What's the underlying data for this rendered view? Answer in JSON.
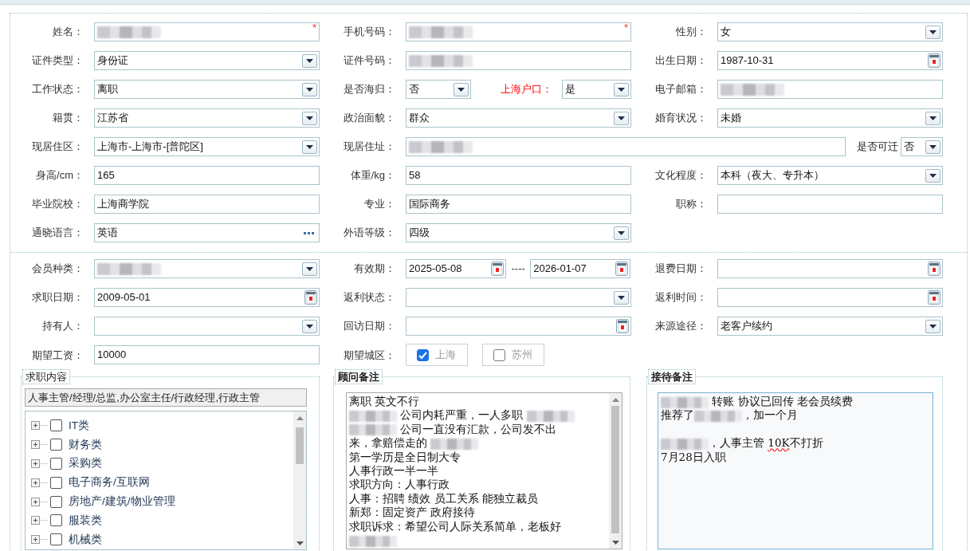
{
  "basic_rows": [
    [
      {
        "label": "姓名：",
        "field": {
          "kind": "text",
          "redacted": true,
          "required_mark": "*"
        }
      },
      {
        "label": "手机号码：",
        "field": {
          "kind": "text",
          "redacted": true,
          "required_mark": "*"
        }
      },
      {
        "label": "性别：",
        "field": {
          "kind": "select",
          "value": "女"
        }
      }
    ],
    [
      {
        "label": "证件类型：",
        "field": {
          "kind": "select",
          "value": "身份证"
        }
      },
      {
        "label": "证件号码：",
        "field": {
          "kind": "text",
          "redacted": true
        }
      },
      {
        "label": "出生日期：",
        "field": {
          "kind": "date",
          "value": "1987-10-31"
        }
      }
    ],
    [
      {
        "label": "工作状态：",
        "field": {
          "kind": "select",
          "value": "离职"
        }
      },
      {
        "label": "是否海归：",
        "field": {
          "kind": "select",
          "value": "否"
        },
        "extra": {
          "label": "上海户口：",
          "highlighted": true,
          "field": {
            "kind": "select",
            "value": "是"
          }
        }
      },
      {
        "label": "电子邮箱：",
        "field": {
          "kind": "text",
          "redacted": true
        }
      }
    ],
    [
      {
        "label": "籍贯：",
        "field": {
          "kind": "select",
          "value": "江苏省"
        }
      },
      {
        "label": "政治面貌：",
        "field": {
          "kind": "select",
          "value": "群众"
        }
      },
      {
        "label": "婚育状况：",
        "field": {
          "kind": "select",
          "value": "未婚"
        }
      }
    ],
    [
      {
        "label": "现居住区：",
        "field": {
          "kind": "select",
          "value": " 上海市-上海市-[普陀区]"
        }
      },
      {
        "label": "现居住址：",
        "wide": true,
        "field": {
          "kind": "text",
          "redacted": true
        },
        "extra": {
          "label": "是否可迁",
          "highlighted": false,
          "field": {
            "kind": "select",
            "value": "否"
          }
        }
      }
    ],
    [
      {
        "label": "身高/cm：",
        "field": {
          "kind": "text",
          "value": "165"
        }
      },
      {
        "label": "体重/kg：",
        "field": {
          "kind": "text",
          "value": "58"
        }
      },
      {
        "label": "文化程度：",
        "field": {
          "kind": "select",
          "value": "本科（夜大、专升本）"
        }
      }
    ],
    [
      {
        "label": "毕业院校：",
        "field": {
          "kind": "text",
          "value": "上海商学院"
        }
      },
      {
        "label": "专业：",
        "field": {
          "kind": "text",
          "value": "国际商务"
        }
      },
      {
        "label": "职称：",
        "field": {
          "kind": "text"
        }
      }
    ],
    [
      {
        "label": "通晓语言：",
        "field": {
          "kind": "picker",
          "value": "英语"
        }
      },
      {
        "label": "外语等级：",
        "field": {
          "kind": "select",
          "value": "四级"
        }
      }
    ]
  ],
  "member_rows": [
    [
      {
        "label": "会员种类：",
        "field": {
          "kind": "select",
          "redacted": true
        }
      },
      {
        "label": "有效期：",
        "field": {
          "kind": "date_range",
          "separator": "----",
          "values": [
            {
              "value": "2025-05-08"
            },
            {
              "value": "2026-01-07"
            }
          ]
        }
      },
      {
        "label": "退费日期：",
        "field": {
          "kind": "date"
        }
      }
    ],
    [
      {
        "label": "求职日期：",
        "field": {
          "kind": "date",
          "value": "2009-05-01"
        }
      },
      {
        "label": "返利状态：",
        "field": {
          "kind": "select"
        }
      },
      {
        "label": "返利时间：",
        "field": {
          "kind": "date"
        }
      }
    ],
    [
      {
        "label": "持有人：",
        "field": {
          "kind": "select"
        }
      },
      {
        "label": "回访日期：",
        "field": {
          "kind": "date"
        }
      },
      {
        "label": "来源途径：",
        "field": {
          "kind": "select",
          "value": "老客户续约"
        }
      }
    ],
    [
      {
        "label": "期望工资：",
        "field": {
          "kind": "text",
          "value": "10000"
        }
      },
      {
        "label": "期望城区：",
        "field": {
          "kind": "checkboxes",
          "options": [
            {
              "label": "上海",
              "checked": true
            },
            {
              "label": "苏州",
              "checked": false
            }
          ]
        }
      }
    ]
  ],
  "panels": [
    {
      "kind": "tree",
      "title": "求职内容",
      "emphasized": false,
      "summary": "人事主管/经理/总监,办公室主任/行政经理,行政主管",
      "items": [
        {
          "label": "IT类",
          "expanded": false,
          "checked": false
        },
        {
          "label": "财务类",
          "expanded": false,
          "checked": false
        },
        {
          "label": "采购类",
          "expanded": false,
          "checked": false
        },
        {
          "label": "电子商务/互联网",
          "expanded": false,
          "checked": false
        },
        {
          "label": "房地产/建筑/物业管理",
          "expanded": false,
          "checked": false
        },
        {
          "label": "服装类",
          "expanded": false,
          "checked": false
        },
        {
          "label": "机械类",
          "expanded": false,
          "checked": false
        }
      ]
    },
    {
      "kind": "notes",
      "title": "顾问备注",
      "emphasized": true,
      "focused": false,
      "lines": [
        {
          "segments": [
            {
              "text": "离职  英文不行"
            }
          ]
        },
        {
          "segments": [
            {
              "redacted": true
            },
            {
              "text": " 公司内耗严重，一人多职 "
            },
            {
              "redacted": true
            }
          ]
        },
        {
          "segments": [
            {
              "redacted": true
            },
            {
              "text": " 公司一直没有汇款，公司发不出"
            }
          ]
        },
        {
          "segments": [
            {
              "text": "来，拿赔偿走的 "
            },
            {
              "redacted": true
            }
          ]
        },
        {
          "segments": [
            {
              "text": "第一学历是全日制大专"
            }
          ]
        },
        {
          "segments": [
            {
              "text": "人事行政一半一半"
            }
          ]
        },
        {
          "segments": [
            {
              "text": "求职方向：人事行政"
            }
          ]
        },
        {
          "segments": [
            {
              "text": "人事：招聘 绩效 员工关系   能独立裁员"
            }
          ]
        },
        {
          "segments": [
            {
              "text": "新郑：固定资产 政府接待"
            }
          ]
        },
        {
          "segments": [
            {
              "text": "求职诉求：希望公司人际关系简单，老板好"
            }
          ]
        },
        {
          "segments": [
            {
              "redacted": true
            }
          ]
        }
      ]
    },
    {
      "kind": "notes",
      "title": "接待备注",
      "emphasized": true,
      "focused": true,
      "lines": [
        {
          "segments": [
            {
              "redacted": true
            },
            {
              "text": "  转账  协议已回传   老会员续费"
            }
          ]
        },
        {
          "segments": [
            {
              "text": "推荐了"
            },
            {
              "redacted": true
            },
            {
              "text": "，加一个月"
            }
          ]
        },
        {
          "spaced": true,
          "segments": [
            {
              "redacted": true
            },
            {
              "text": "，人事主管 "
            },
            {
              "text": "10K",
              "misspelled": true
            },
            {
              "text": "不打折"
            }
          ]
        },
        {
          "segments": [
            {
              "text": "7月28日入职"
            }
          ]
        }
      ]
    }
  ]
}
